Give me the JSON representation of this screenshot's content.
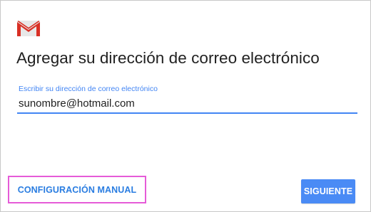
{
  "app": {
    "logo_icon": "gmail-logo-icon"
  },
  "header": {
    "title": "Agregar su dirección de correo electrónico"
  },
  "email_field": {
    "label": "Escribir su dirección de correo electrónico",
    "value": "sunombre@hotmail.com"
  },
  "actions": {
    "manual_config_label": "CONFIGURACIÓN MANUAL",
    "next_label": "SIGUIENTE"
  },
  "colors": {
    "accent": "#4285f4",
    "button_primary": "#4a8bf5",
    "link_text": "#2a7de1",
    "highlight_box": "#e65bd8",
    "gmail_red": "#d93025"
  }
}
